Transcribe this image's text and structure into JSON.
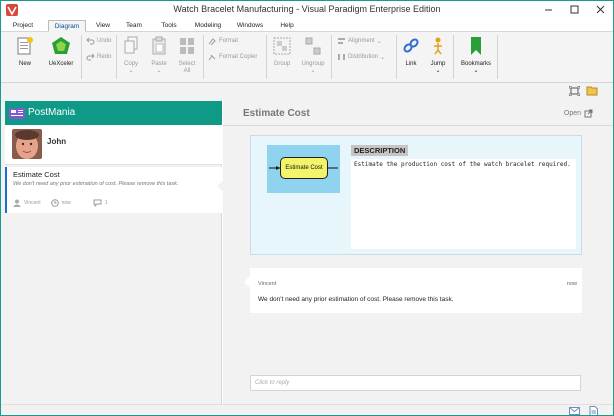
{
  "window": {
    "title": "Watch Bracelet Manufacturing - Visual Paradigm Enterprise Edition",
    "controls": [
      "minimize",
      "maximize",
      "close"
    ]
  },
  "menu": {
    "tabs": [
      {
        "label": "Project",
        "active": false
      },
      {
        "label": "Diagram",
        "active": true
      },
      {
        "label": "View",
        "active": false
      },
      {
        "label": "Team",
        "active": false
      },
      {
        "label": "Tools",
        "active": false
      },
      {
        "label": "Modeling",
        "active": false
      },
      {
        "label": "Windows",
        "active": false
      },
      {
        "label": "Help",
        "active": false
      }
    ]
  },
  "ribbon": {
    "new": "New",
    "uexceler": "UeXceler",
    "undo": "Undo",
    "redo": "Redo",
    "copy": "Copy",
    "paste": "Paste",
    "select_all_1": "Select",
    "select_all_2": "All",
    "format": "Format",
    "format_copier": "Format Copier",
    "group": "Group",
    "ungroup": "Ungroup",
    "alignment": "Alignment",
    "distribution": "Distribution",
    "link": "Link",
    "jump": "Jump",
    "bookmarks": "Bookmarks"
  },
  "postmania": {
    "title": "PostMania",
    "user": "John",
    "post": {
      "title": "Estimate Cost",
      "text": "We don't need any prior estimation of cost. Please remove this task.",
      "author": "Vincent",
      "time": "now",
      "comment_count": "1"
    }
  },
  "detail": {
    "title": "Estimate Cost",
    "open_label": "Open",
    "diagram_shape": "Estimate Cost",
    "description_label": "DESCRIPTION",
    "description_text": "Estimate the production cost of the watch bracelet required.",
    "comment": {
      "author": "Vincent",
      "time": "now",
      "text": "We don't need any prior estimation of cost. Please remove this task."
    },
    "reply_placeholder": "Click to reply"
  },
  "colors": {
    "accent": "#0f9a87",
    "post_border": "#1b6fd1",
    "desc_bg": "#e6f6fb",
    "diagram_bg": "#8fd3ee",
    "shape_fill": "#f4f46a"
  }
}
